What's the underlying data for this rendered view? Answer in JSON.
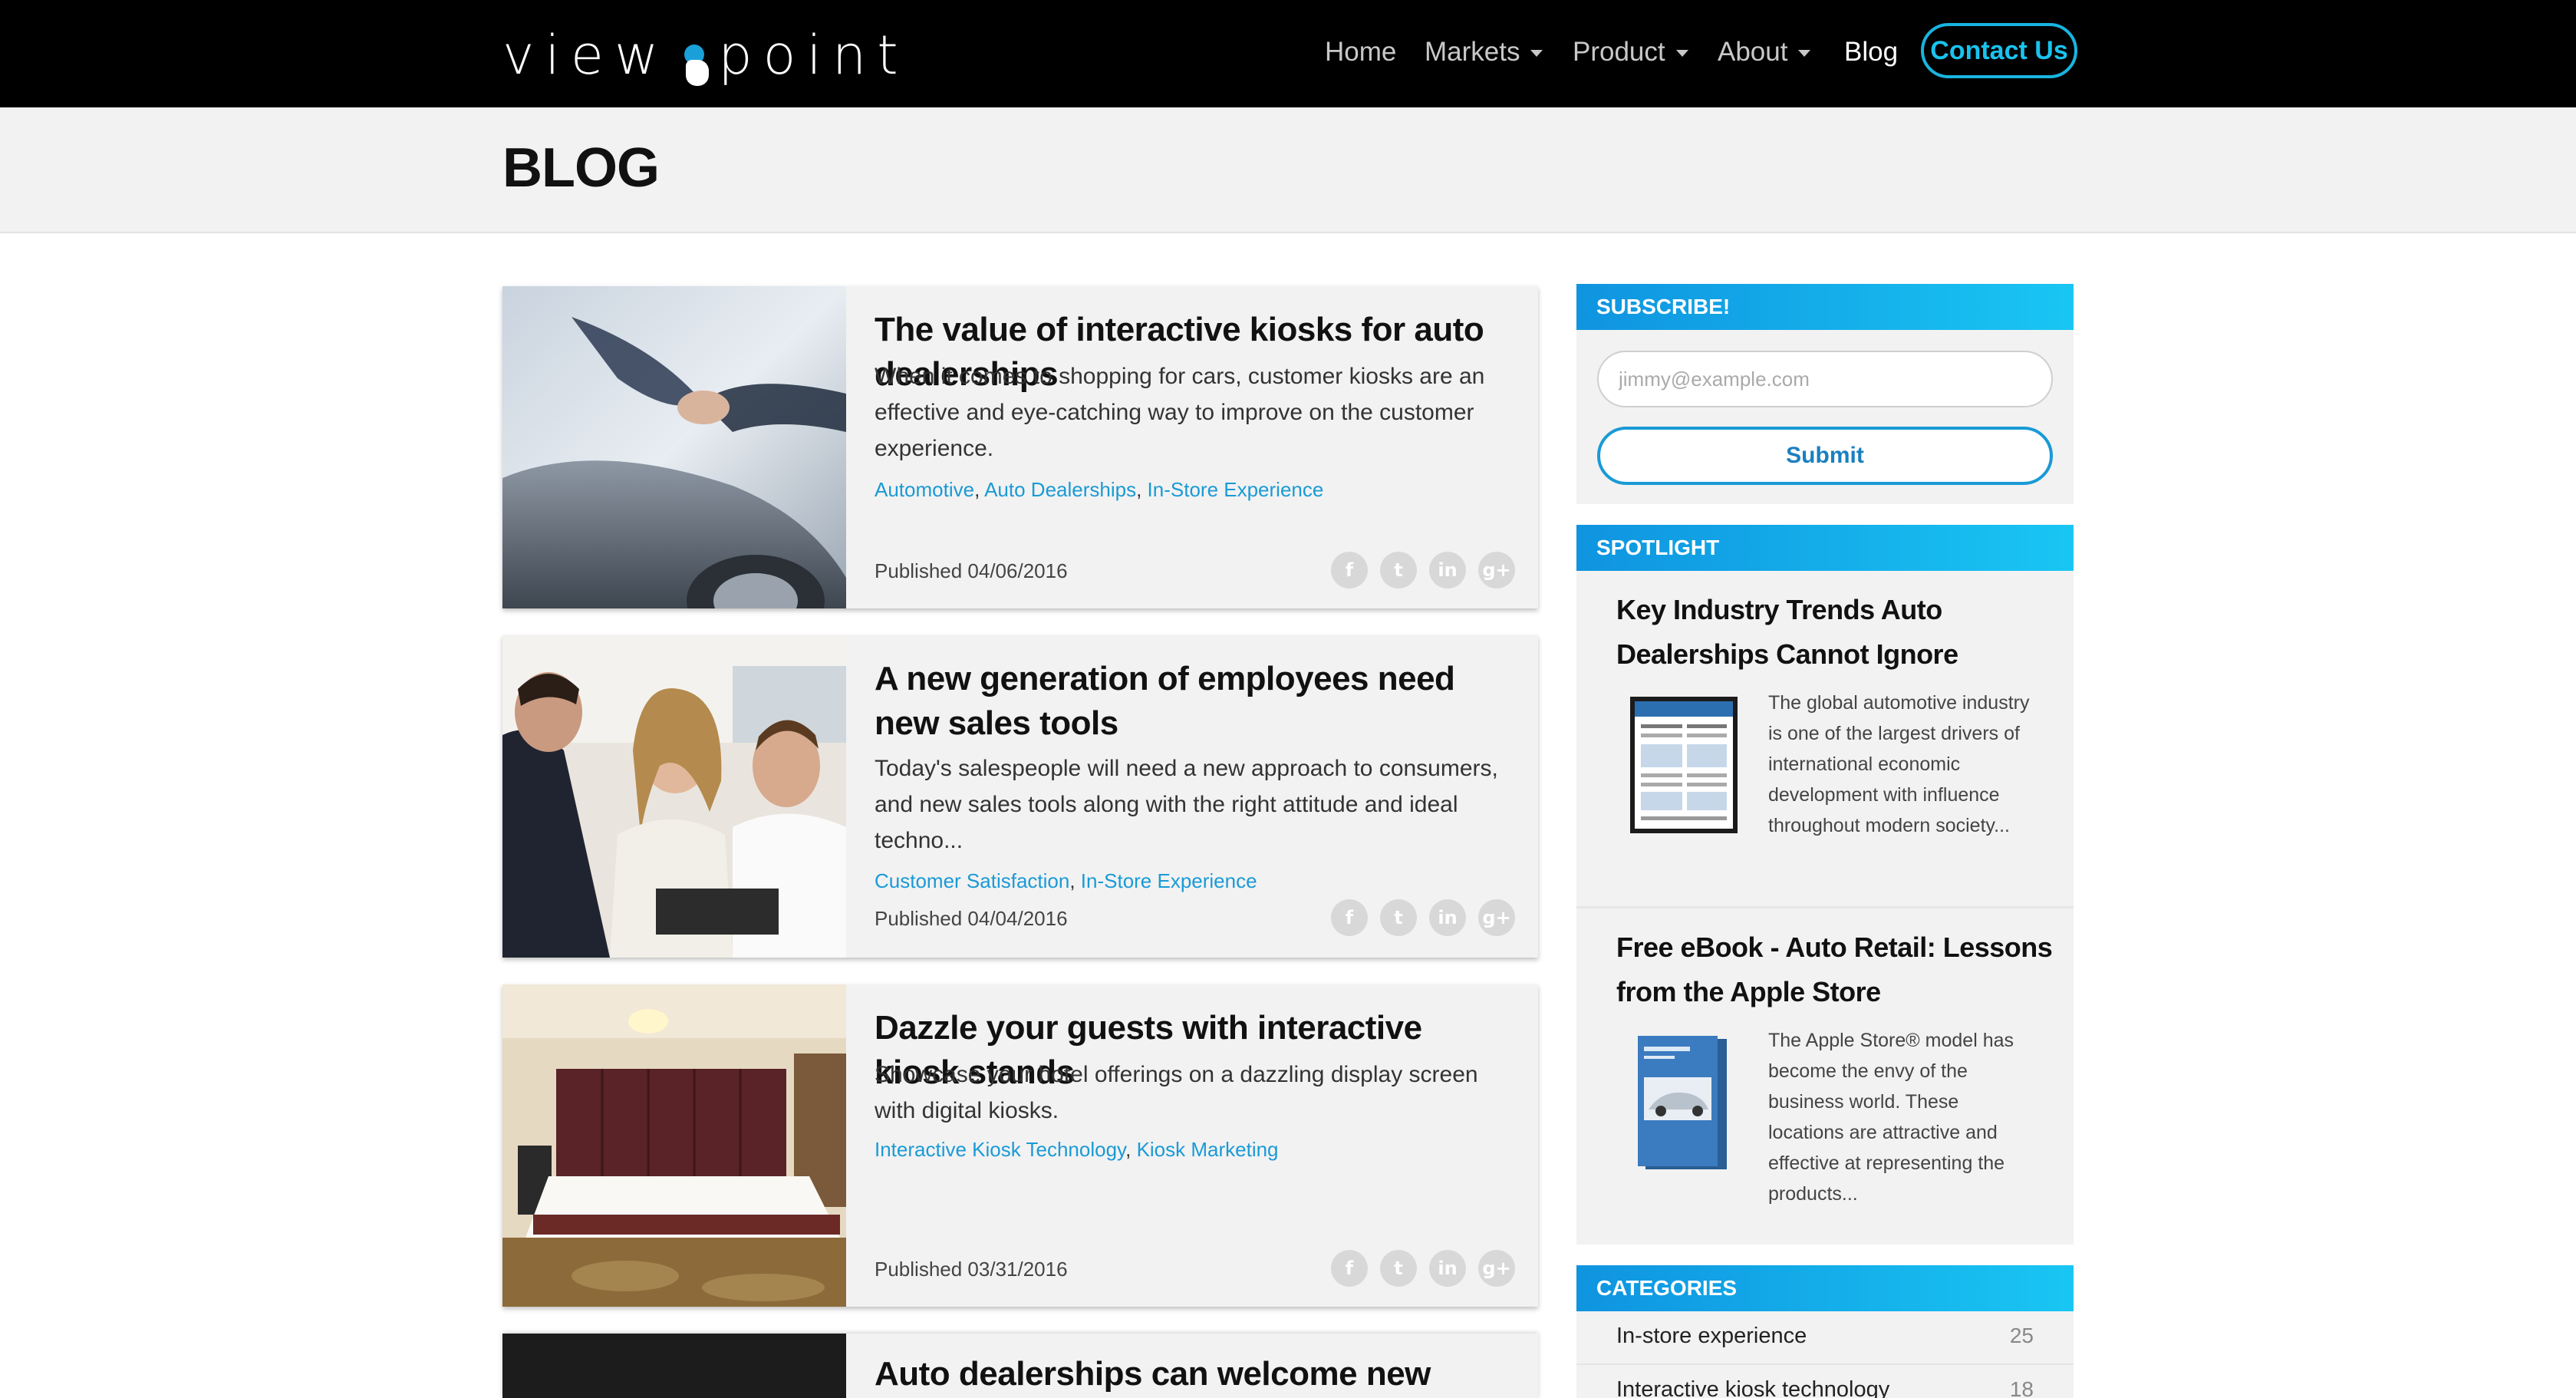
{
  "header": {
    "logo_left": "view",
    "logo_right": "point",
    "nav": [
      {
        "label": "Home",
        "has_caret": false
      },
      {
        "label": "Markets",
        "has_caret": true
      },
      {
        "label": "Product",
        "has_caret": true
      },
      {
        "label": "About",
        "has_caret": true
      },
      {
        "label": "Blog",
        "has_caret": false,
        "active": true
      }
    ],
    "contact_label": "Contact Us"
  },
  "page": {
    "title": "BLOG"
  },
  "posts": [
    {
      "title": "The value of interactive kiosks for auto dealerships",
      "excerpt": "When it comes to shopping for cars, customer kiosks are an effective and eye-catching way to improve on the customer experience.",
      "tags": [
        "Automotive",
        "Auto Dealerships",
        "In-Store Experience"
      ],
      "date": "Published 04/06/2016",
      "image_icon": "handshake-car-photo"
    },
    {
      "title": "A new generation of employees need new sales tools",
      "excerpt": "Today's salespeople will need a new approach to consumers, and new sales tools along with the right attitude and ideal techno...",
      "tags": [
        "Customer Satisfaction",
        "In-Store Experience"
      ],
      "date": "Published 04/04/2016",
      "image_icon": "salesman-customers-photo"
    },
    {
      "title": "Dazzle your guests with interactive kiosk stands",
      "excerpt": "Showcase your hotel offerings on a dazzling display screen with digital kiosks.",
      "tags": [
        "Interactive Kiosk Technology",
        "Kiosk Marketing"
      ],
      "date": "Published 03/31/2016",
      "image_icon": "hotel-room-photo"
    },
    {
      "title": "Auto dealerships can welcome new model years",
      "image_icon": "dark-photo"
    }
  ],
  "social": [
    "f",
    "t",
    "in",
    "g+"
  ],
  "sidebar": {
    "subscribe": {
      "heading": "SUBSCRIBE!",
      "placeholder": "jimmy@example.com",
      "submit_label": "Submit"
    },
    "spotlight": {
      "heading": "SPOTLIGHT",
      "items": [
        {
          "title": "Key Industry Trends Auto Dealerships Cannot Ignore",
          "text": "The global automotive industry is one of the largest drivers of international economic development with influence throughout modern society...",
          "image_icon": "report-document-thumbnail"
        },
        {
          "title": "Free eBook - Auto Retail: Lessons from the Apple Store",
          "text": "The Apple Store® model has become the envy of the business world. These locations are attractive and effective at representing the products...",
          "image_icon": "ebook-cover-thumbnail"
        }
      ]
    },
    "categories": {
      "heading": "CATEGORIES",
      "items": [
        {
          "label": "In-store experience",
          "count": "25"
        },
        {
          "label": "Interactive kiosk technology",
          "count": "18"
        }
      ]
    }
  }
}
